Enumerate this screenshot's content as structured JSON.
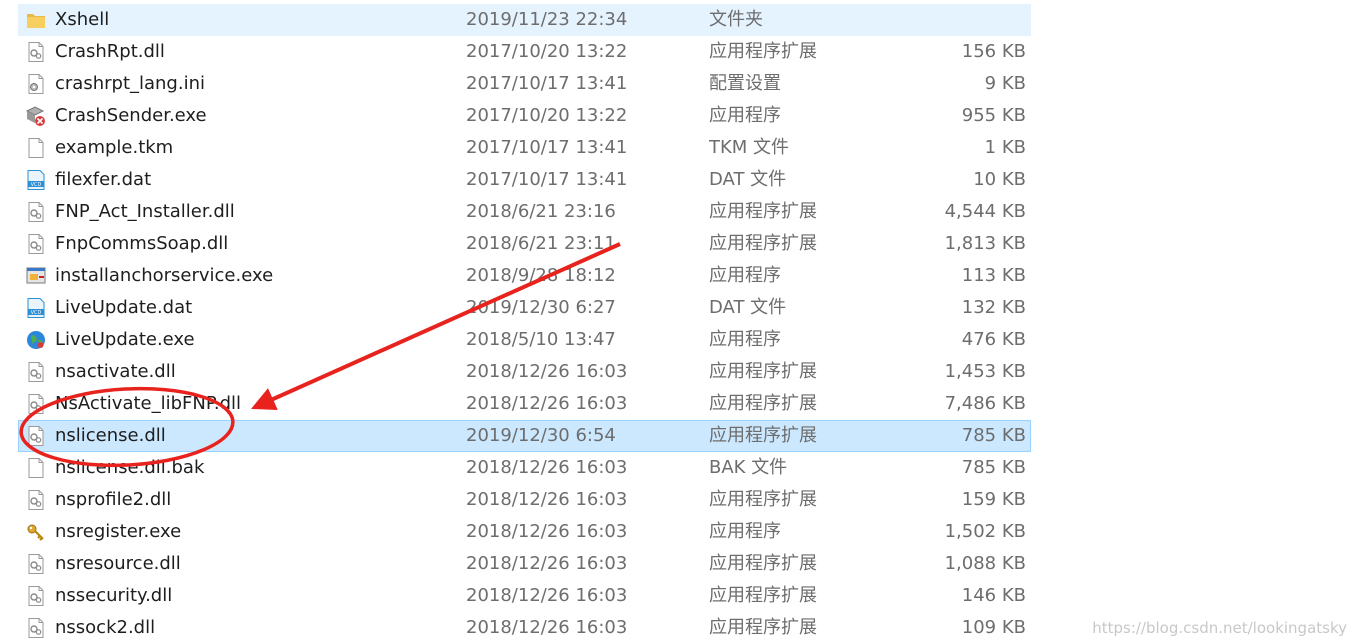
{
  "files": [
    {
      "name": "Xshell",
      "date": "2019/11/23 22:34",
      "type": "文件夹",
      "size": "",
      "icon": "folder-icon",
      "state": "hover"
    },
    {
      "name": "CrashRpt.dll",
      "date": "2017/10/20 13:22",
      "type": "应用程序扩展",
      "size": "156 KB",
      "icon": "dll-icon",
      "state": ""
    },
    {
      "name": "crashrpt_lang.ini",
      "date": "2017/10/17 13:41",
      "type": "配置设置",
      "size": "9 KB",
      "icon": "ini-icon",
      "state": ""
    },
    {
      "name": "CrashSender.exe",
      "date": "2017/10/20 13:22",
      "type": "应用程序",
      "size": "955 KB",
      "icon": "crash-sender-icon",
      "state": ""
    },
    {
      "name": "example.tkm",
      "date": "2017/10/17 13:41",
      "type": "TKM 文件",
      "size": "1 KB",
      "icon": "blank-file-icon",
      "state": ""
    },
    {
      "name": "filexfer.dat",
      "date": "2017/10/17 13:41",
      "type": "DAT 文件",
      "size": "10 KB",
      "icon": "vcd-file-icon",
      "state": ""
    },
    {
      "name": "FNP_Act_Installer.dll",
      "date": "2018/6/21 23:16",
      "type": "应用程序扩展",
      "size": "4,544 KB",
      "icon": "dll-icon",
      "state": ""
    },
    {
      "name": "FnpCommsSoap.dll",
      "date": "2018/6/21 23:11",
      "type": "应用程序扩展",
      "size": "1,813 KB",
      "icon": "dll-icon",
      "state": ""
    },
    {
      "name": "installanchorservice.exe",
      "date": "2018/9/28 18:12",
      "type": "应用程序",
      "size": "113 KB",
      "icon": "installer-exe-icon",
      "state": ""
    },
    {
      "name": "LiveUpdate.dat",
      "date": "2019/12/30 6:27",
      "type": "DAT 文件",
      "size": "132 KB",
      "icon": "vcd-file-icon",
      "state": ""
    },
    {
      "name": "LiveUpdate.exe",
      "date": "2018/5/10 13:47",
      "type": "应用程序",
      "size": "476 KB",
      "icon": "globe-exe-icon",
      "state": ""
    },
    {
      "name": "nsactivate.dll",
      "date": "2018/12/26 16:03",
      "type": "应用程序扩展",
      "size": "1,453 KB",
      "icon": "dll-icon",
      "state": ""
    },
    {
      "name": "NsActivate_libFNP.dll",
      "date": "2018/12/26 16:03",
      "type": "应用程序扩展",
      "size": "7,486 KB",
      "icon": "dll-icon",
      "state": ""
    },
    {
      "name": "nslicense.dll",
      "date": "2019/12/30 6:54",
      "type": "应用程序扩展",
      "size": "785 KB",
      "icon": "dll-icon",
      "state": "selected"
    },
    {
      "name": "nslicense.dll.bak",
      "date": "2018/12/26 16:03",
      "type": "BAK 文件",
      "size": "785 KB",
      "icon": "blank-file-icon",
      "state": ""
    },
    {
      "name": "nsprofile2.dll",
      "date": "2018/12/26 16:03",
      "type": "应用程序扩展",
      "size": "159 KB",
      "icon": "dll-icon",
      "state": ""
    },
    {
      "name": "nsregister.exe",
      "date": "2018/12/26 16:03",
      "type": "应用程序",
      "size": "1,502 KB",
      "icon": "key-exe-icon",
      "state": ""
    },
    {
      "name": "nsresource.dll",
      "date": "2018/12/26 16:03",
      "type": "应用程序扩展",
      "size": "1,088 KB",
      "icon": "dll-icon",
      "state": ""
    },
    {
      "name": "nssecurity.dll",
      "date": "2018/12/26 16:03",
      "type": "应用程序扩展",
      "size": "146 KB",
      "icon": "dll-icon",
      "state": ""
    },
    {
      "name": "nssock2.dll",
      "date": "2018/12/26 16:03",
      "type": "应用程序扩展",
      "size": "109 KB",
      "icon": "dll-icon",
      "state": ""
    }
  ],
  "annotation": {
    "color": "#e8231e"
  },
  "watermark": "https://blog.csdn.net/lookingatsky"
}
